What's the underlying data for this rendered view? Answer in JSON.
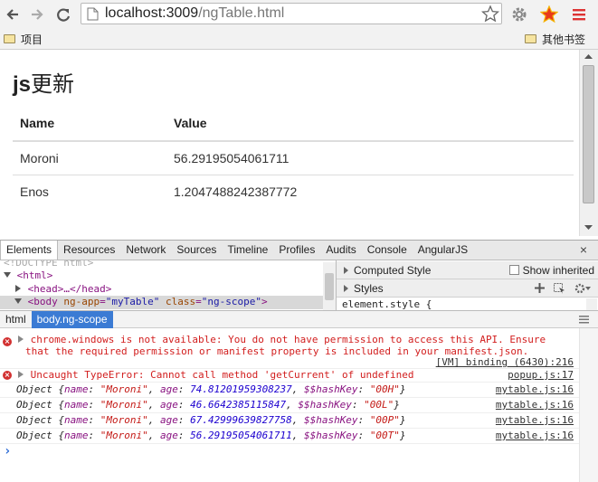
{
  "browser": {
    "url_host": "localhost:3009",
    "url_path": "/ngTable.html",
    "bookmarks": {
      "left": "项目",
      "right": "其他书签"
    }
  },
  "page": {
    "title_latin": "js",
    "title_cjk": "更新",
    "table": {
      "headers": [
        "Name",
        "Value"
      ],
      "rows": [
        {
          "name": "Moroni",
          "value": "56.29195054061711"
        },
        {
          "name": "Enos",
          "value": "1.2047488242387772"
        }
      ]
    }
  },
  "devtools": {
    "tabs": [
      "Elements",
      "Resources",
      "Network",
      "Sources",
      "Timeline",
      "Profiles",
      "Audits",
      "Console",
      "AngularJS"
    ],
    "active_tab": "Elements",
    "elements": {
      "comment_line": "<!DOCTYPE html>",
      "html_tag": "<html>",
      "head_line": "<head>…</head>",
      "body_tag_open": "<body",
      "body_attr1_name": "ng-app",
      "body_attr1_value": "\"myTable\"",
      "body_attr2_name": "class",
      "body_attr2_value": "\"ng-scope\"",
      "body_tag_close": ">"
    },
    "styles": {
      "computed_label": "Computed Style",
      "show_inherited_label": "Show inherited",
      "styles_label": "Styles",
      "element_style": "element.style {"
    },
    "breadcrumbs": [
      "html",
      "body.ng-scope"
    ],
    "console": {
      "error1_line1": "chrome.windows is not available: You do not have permission to access this API. Ensure",
      "error1_line2": "that the required permission or manifest property is included in your manifest.json.",
      "error1_source": "[VM] binding (6430):216",
      "error2": "Uncaught TypeError: Cannot call method 'getCurrent' of undefined",
      "error2_source": "popup.js:17",
      "objects": [
        {
          "name": "\"Moroni\"",
          "age": "74.81201959308237",
          "hash": "\"00H\"",
          "source": "mytable.js:16"
        },
        {
          "name": "\"Moroni\"",
          "age": "46.6642385115847",
          "hash": "\"00L\"",
          "source": "mytable.js:16"
        },
        {
          "name": "\"Moroni\"",
          "age": "67.42999639827758",
          "hash": "\"00P\"",
          "source": "mytable.js:16"
        },
        {
          "name": "\"Moroni\"",
          "age": "56.29195054061711",
          "hash": "\"00T\"",
          "source": "mytable.js:16"
        }
      ],
      "object_prefix": "Object",
      "key_name": "name",
      "key_age": "age",
      "key_hash": "$$hashKey",
      "prompt": "›"
    }
  }
}
